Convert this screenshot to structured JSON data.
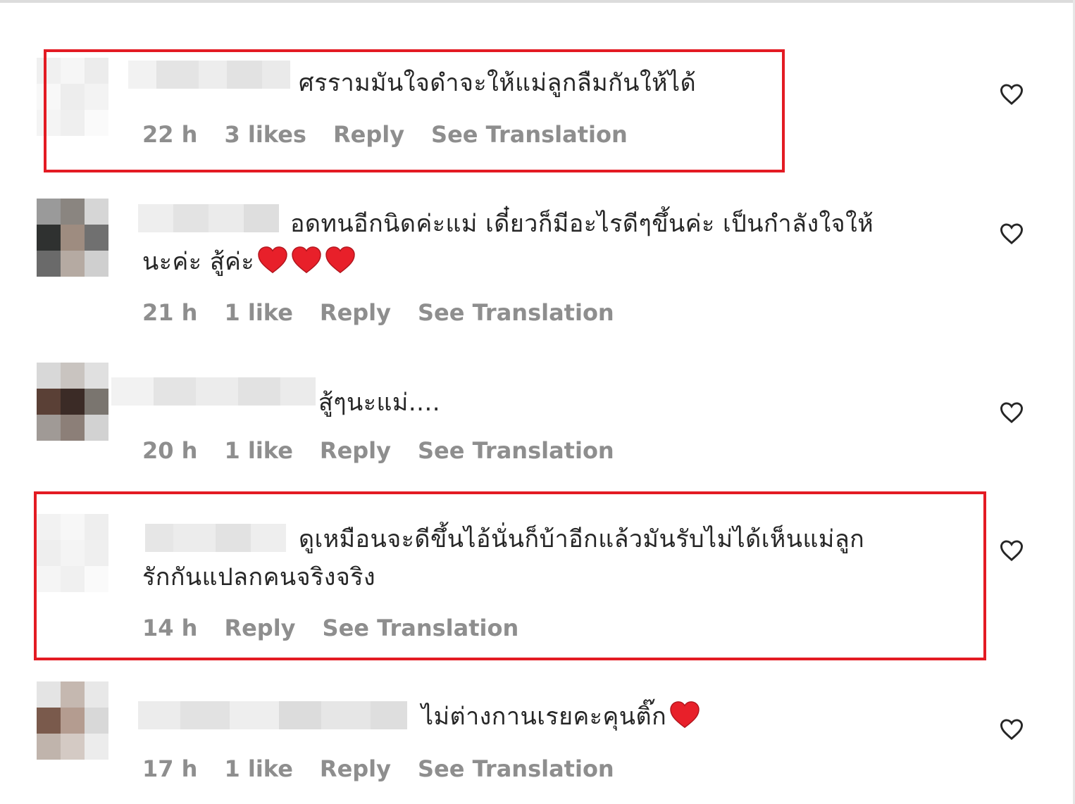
{
  "colors": {
    "highlight": "#e31b23",
    "meta_text": "#8e8e8e",
    "heart_emoji": "#e8202a"
  },
  "comments": [
    {
      "text_line1": "ศรรามมันใจดำจะให้แม่ลูกลืมกันให้ได้",
      "text_line2": "",
      "time": "22 h",
      "likes": "3 likes",
      "reply": "Reply",
      "translate": "See Translation",
      "hearts_in_text": 0,
      "highlighted": true
    },
    {
      "text_line1": "อดทนอีกนิดค่ะแม่ เดี๋ยวก็มีอะไรดีๆขึ้นค่ะ เป็นกำลังใจให้",
      "text_line2": "นะค่ะ สู้ค่ะ",
      "time": "21 h",
      "likes": "1 like",
      "reply": "Reply",
      "translate": "See Translation",
      "hearts_in_text": 3,
      "highlighted": false
    },
    {
      "text_line1": "สู้ๆนะแม่....",
      "text_line2": "",
      "time": "20 h",
      "likes": "1 like",
      "reply": "Reply",
      "translate": "See Translation",
      "hearts_in_text": 0,
      "highlighted": false
    },
    {
      "text_line1": "ดูเหมือนจะดีขึ้นไอ้นั่นก็บ้าอีกแล้วมันรับไม่ได้เห็นแม่ลูก",
      "text_line2": "รักกันแปลกคนจริงจริง",
      "time": "14 h",
      "likes": "",
      "reply": "Reply",
      "translate": "See Translation",
      "hearts_in_text": 0,
      "highlighted": true
    },
    {
      "text_line1": "ไม่ต่างกานเรยคะคุนติ๊ก",
      "text_line2": "",
      "time": "17 h",
      "likes": "1 like",
      "reply": "Reply",
      "translate": "See Translation",
      "hearts_in_text": 1,
      "highlighted": false
    }
  ]
}
